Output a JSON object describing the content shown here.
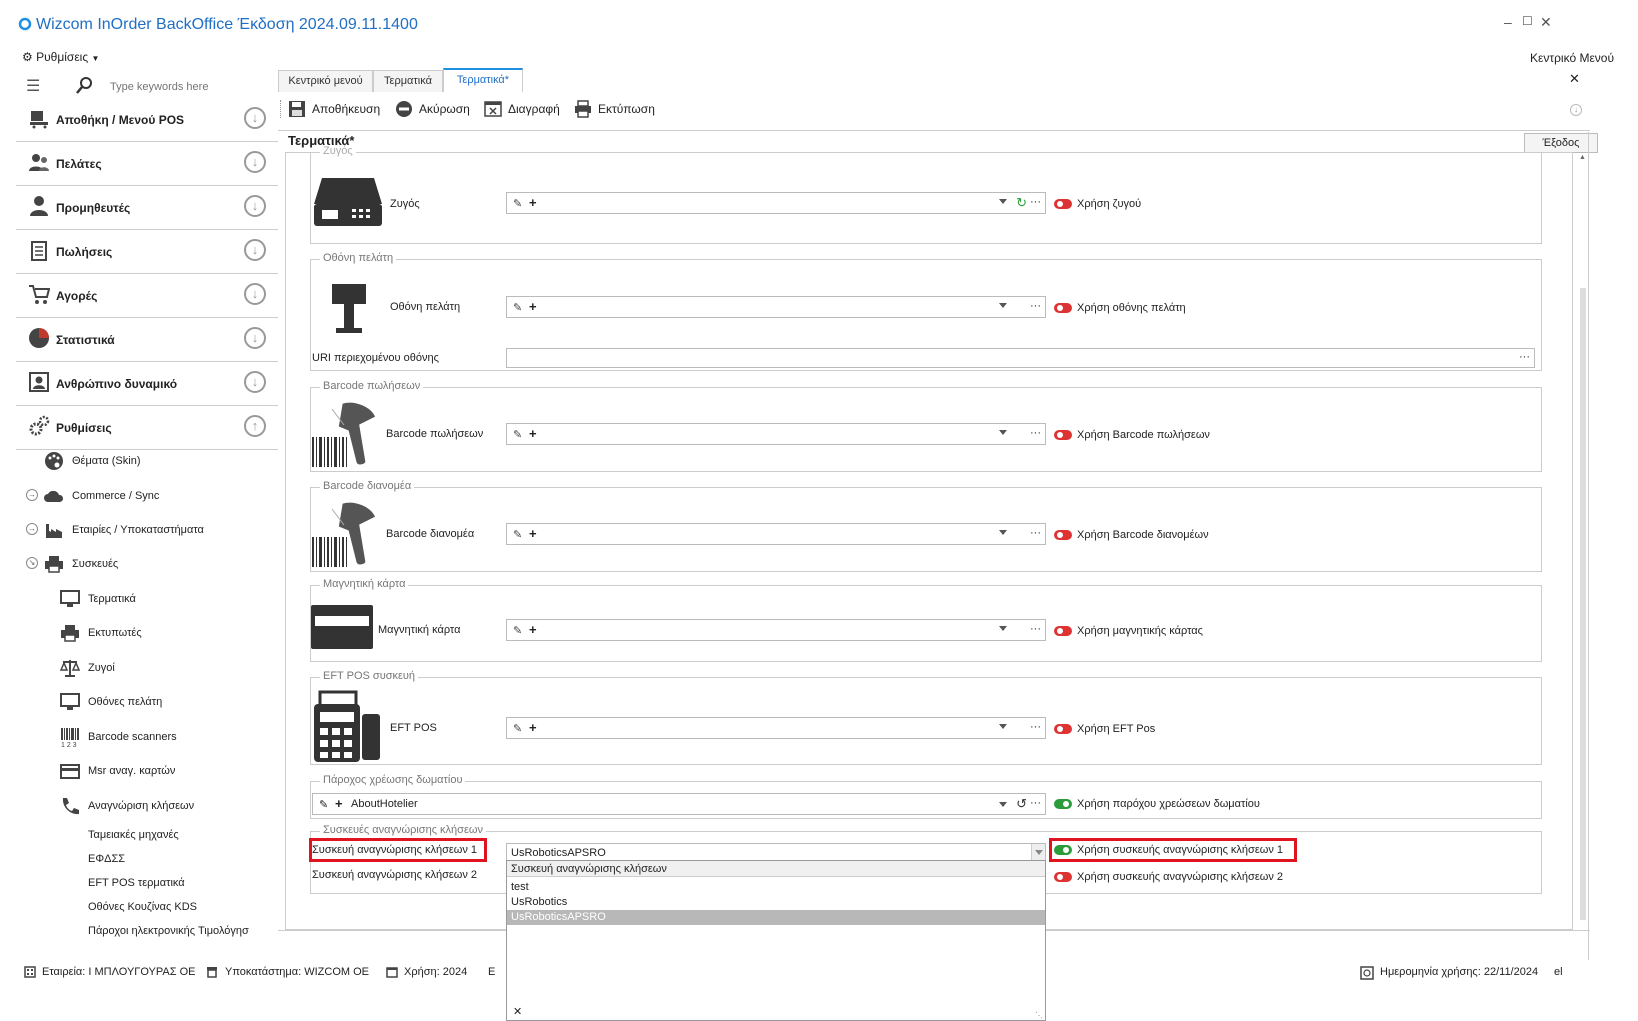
{
  "app": {
    "title": "Wizcom InOrder BackOffice Έκδοση 2024.09.11.1400",
    "settings_menu": "Ρυθμίσεις",
    "main_menu_label": "Κεντρικό Μενού"
  },
  "sidebar": {
    "search_placeholder": "Type keywords here",
    "categories": [
      {
        "label": "Αποθήκη / Μενού POS",
        "icon": "warehouse-icon"
      },
      {
        "label": "Πελάτες",
        "icon": "customers-icon"
      },
      {
        "label": "Προμηθευτές",
        "icon": "supplier-icon"
      },
      {
        "label": "Πωλήσεις",
        "icon": "sales-icon"
      },
      {
        "label": "Αγορές",
        "icon": "cart-icon"
      },
      {
        "label": "Στατιστικά",
        "icon": "stats-icon"
      },
      {
        "label": "Ανθρώπινο δυναμικό",
        "icon": "hr-icon"
      },
      {
        "label": "Ρυθμίσεις",
        "icon": "gears-icon"
      }
    ],
    "settings_items": [
      {
        "label": "Θέματα (Skin)",
        "icon": "palette-icon"
      },
      {
        "label": "Commerce / Sync",
        "icon": "cloud-icon"
      },
      {
        "label": "Εταιρίες / Υποκαταστήματα",
        "icon": "factory-icon"
      },
      {
        "label": "Συσκευές",
        "icon": "printer-icon"
      }
    ],
    "device_items": [
      {
        "label": "Τερματικά",
        "icon": "monitor-icon"
      },
      {
        "label": "Εκτυπωτές",
        "icon": "printer-icon"
      },
      {
        "label": "Ζυγοί",
        "icon": "scale-icon"
      },
      {
        "label": "Οθόνες πελάτη",
        "icon": "monitor-icon"
      },
      {
        "label": "Barcode scanners",
        "icon": "barcode-icon"
      },
      {
        "label": "Msr αναγ. καρτών",
        "icon": "card-icon"
      },
      {
        "label": "Αναγνώριση κλήσεων",
        "icon": "phone-icon"
      }
    ],
    "more_items": [
      "Ταμειακές μηχανές",
      "ΕΦΔΣΣ",
      "EFT POS τερματικά",
      "Οθόνες Κουζίνας KDS",
      "Πάροχοι ηλεκτρονικής Τιμολόγησ"
    ]
  },
  "tabs": [
    {
      "label": "Κεντρικό μενού"
    },
    {
      "label": "Τερματικά"
    },
    {
      "label": "Τερματικά*"
    }
  ],
  "toolbar": {
    "save": "Αποθήκευση",
    "cancel": "Ακύρωση",
    "delete": "Διαγραφή",
    "print": "Εκτύπωση"
  },
  "panel": {
    "title": "Τερματικά*",
    "exit": "Έξοδος"
  },
  "form": {
    "scale_group": "Ζυγός",
    "scale_label": "Ζυγός",
    "scale_toggle": "Χρήση ζυγού",
    "display_group": "Οθόνη πελάτη",
    "display_label": "Οθόνη πελάτη",
    "display_toggle": "Χρήση οθόνης πελάτη",
    "display_uri_label": "URI περιεχομένου οθόνης",
    "barcode_sales_group": "Barcode πωλήσεων",
    "barcode_sales_label": "Barcode πωλήσεων",
    "barcode_sales_toggle": "Χρήση Barcode πωλήσεων",
    "barcode_dist_group": "Barcode διανομέα",
    "barcode_dist_label": "Barcode διανομέα",
    "barcode_dist_toggle": "Χρήση Barcode διανομέων",
    "magcard_group": "Μαγνητική κάρτα",
    "magcard_label": "Μαγνητική κάρτα",
    "magcard_toggle": "Χρήση μαγνητικής κάρτας",
    "eft_group": "EFT POS συσκευή",
    "eft_label": "EFT POS",
    "eft_toggle": "Χρήση EFT Pos",
    "room_group": "Πάροχος χρέωσης δωματίου",
    "room_value": "AboutHotelier",
    "room_toggle": "Χρήση παρόχου χρεώσεων δωματίου",
    "caller_group": "Συσκευές αναγνώρισης κλήσεων",
    "caller1_label": "Συσκευή αναγνώρισης κλήσεων 1",
    "caller1_value": "UsRoboticsAPSRO",
    "caller1_toggle": "Χρήση συσκευής αναγνώρισης κλήσεων 1",
    "caller2_label": "Συσκευή αναγνώρισης κλήσεων 2",
    "caller2_toggle": "Χρήση συσκευής αναγνώρισης κλήσεων 2"
  },
  "dropdown": {
    "header": "Συσκευή αναγνώρισης κλήσεων",
    "options": [
      "test",
      "UsRobotics",
      "UsRoboticsAPSRO"
    ],
    "selected": "UsRoboticsAPSRO"
  },
  "statusbar": {
    "company": "Εταιρεία: Ι ΜΠΛΟΥΓΟΥΡΑΣ ΟΕ",
    "branch": "Υποκατάστημα: WIZCOM OE",
    "year": "Χρήση: 2024",
    "partial": "Ε",
    "date": "Ημερομηνία χρήσης: 22/11/2024",
    "lang": "el"
  },
  "colors": {
    "accent": "#1f6fc5",
    "toggle_off": "#dd3333",
    "toggle_on": "#2a9d3a",
    "highlight": "#e0141e"
  }
}
